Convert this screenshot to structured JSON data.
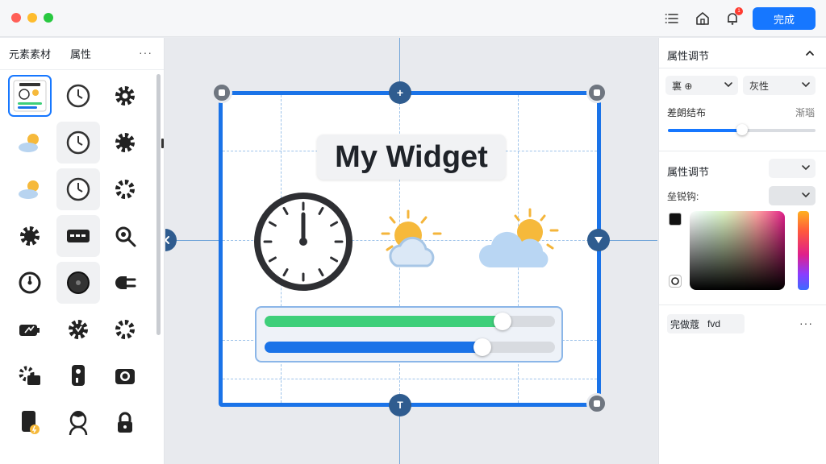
{
  "titlebar": {
    "done_label": "完成",
    "notification_count": "1",
    "traffic_colors": [
      "#ff5f57",
      "#febc2e",
      "#28c840"
    ]
  },
  "left_panel": {
    "tabs": [
      "元素素材",
      "属性"
    ],
    "more_label": "···",
    "assets": [
      [
        "widget-thumbnail",
        "clock",
        "gear"
      ],
      [
        "weather-sun-cloud",
        "clock",
        "gear"
      ],
      [
        "weather-sun-cloud",
        "clock",
        "gear"
      ],
      [
        "gear",
        "card",
        "search-gear"
      ],
      [
        "gauge",
        "gauge-dark",
        "plug"
      ],
      [
        "battery",
        "gear-shield",
        "gear"
      ],
      [
        "gear-folder",
        "device",
        "camera"
      ],
      [
        "phone-bolt",
        "avatar",
        "lock"
      ]
    ]
  },
  "canvas": {
    "widget_title": "My Widget",
    "slider_green": 0.82,
    "slider_blue": 0.75,
    "colors": {
      "green": "#3ecf7a",
      "blue": "#1a73e8"
    }
  },
  "right_panel": {
    "section1_title": "属性调节",
    "select1": "裏 ⊕",
    "select2": "灰性",
    "slider_label": "差朗结布",
    "slider_value_label": "渐瑙",
    "slider_value": 0.5,
    "section2_title": "属性调节",
    "color_label": "垒锐钩:",
    "field_label": "完做蔻",
    "field_value": "fvd",
    "more_label": "···"
  }
}
